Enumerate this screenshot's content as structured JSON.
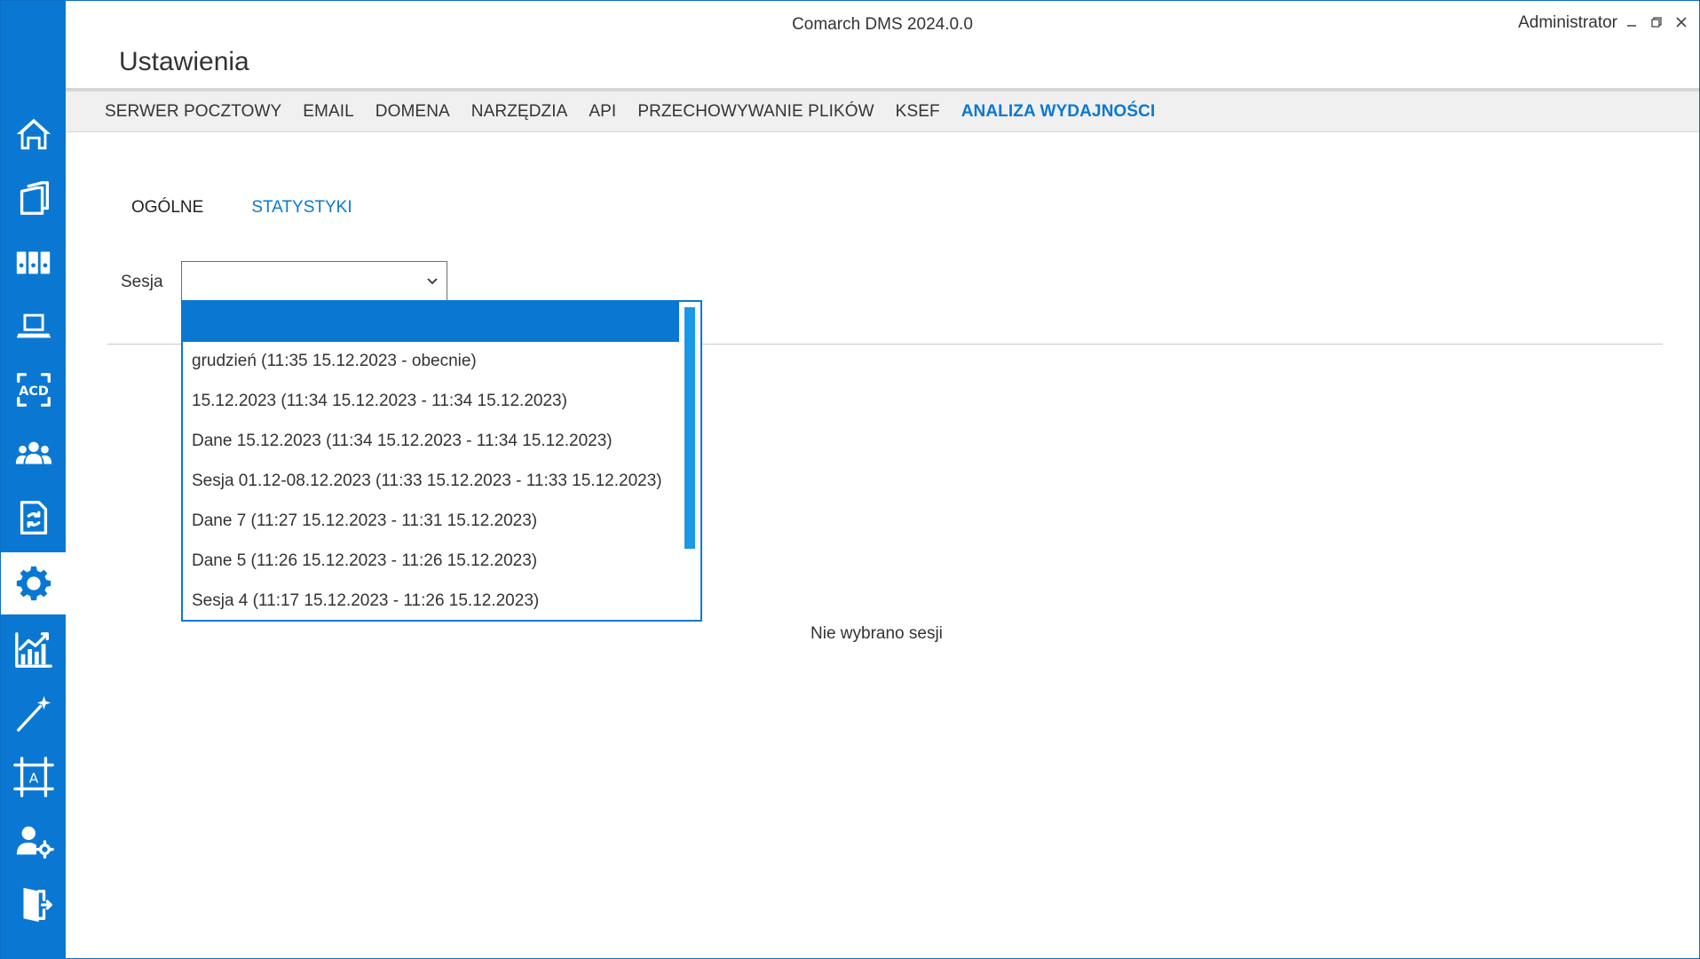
{
  "window": {
    "app_title": "Comarch DMS 2024.0.0",
    "user": "Administrator",
    "controls": [
      "minimize-icon",
      "restore-icon",
      "close-icon"
    ]
  },
  "page": {
    "title": "Ustawienia"
  },
  "sidebar": {
    "items": [
      {
        "name": "home",
        "icon": "home-icon"
      },
      {
        "name": "documents",
        "icon": "documents-icon"
      },
      {
        "name": "archive",
        "icon": "archive-binders-icon"
      },
      {
        "name": "workstation",
        "icon": "laptop-icon"
      },
      {
        "name": "acd",
        "icon": "acd-icon"
      },
      {
        "name": "users",
        "icon": "users-group-icon"
      },
      {
        "name": "document-sync",
        "icon": "document-sync-icon"
      },
      {
        "name": "settings",
        "icon": "gear-icon",
        "active": true
      },
      {
        "name": "reports",
        "icon": "chart-icon"
      },
      {
        "name": "wizard",
        "icon": "magic-wand-icon"
      },
      {
        "name": "templates",
        "icon": "template-frame-icon"
      },
      {
        "name": "user-settings",
        "icon": "user-gear-icon"
      },
      {
        "name": "logout",
        "icon": "logout-door-icon"
      }
    ]
  },
  "nav": {
    "tabs": [
      {
        "label": "SERWER POCZTOWY"
      },
      {
        "label": "EMAIL"
      },
      {
        "label": "DOMENA"
      },
      {
        "label": "NARZĘDZIA"
      },
      {
        "label": "API"
      },
      {
        "label": "PRZECHOWYWANIE PLIKÓW"
      },
      {
        "label": "KSEF"
      },
      {
        "label": "ANALIZA WYDAJNOŚCI",
        "active": true
      }
    ]
  },
  "subtabs": {
    "items": [
      {
        "label": "OGÓLNE"
      },
      {
        "label": "STATYSTYKI",
        "active": true
      }
    ]
  },
  "session": {
    "label": "Sesja",
    "value": "",
    "options": [
      "",
      "grudzień (11:35 15.12.2023 - obecnie)",
      "15.12.2023 (11:34 15.12.2023 - 11:34 15.12.2023)",
      "Dane 15.12.2023 (11:34 15.12.2023 - 11:34 15.12.2023)",
      "Sesja 01.12-08.12.2023 (11:33 15.12.2023 - 11:33 15.12.2023)",
      "Dane 7 (11:27 15.12.2023 - 11:31 15.12.2023)",
      "Dane 5 (11:26 15.12.2023 - 11:26 15.12.2023)",
      "Sesja 4 (11:17 15.12.2023 - 11:26 15.12.2023)"
    ],
    "selected_index": 0
  },
  "content": {
    "empty_message": "Nie wybrano sesji"
  },
  "colors": {
    "accent": "#0a78d2",
    "scrollbar": "#1a9ae6",
    "nav_bg": "#f0f0f0"
  }
}
